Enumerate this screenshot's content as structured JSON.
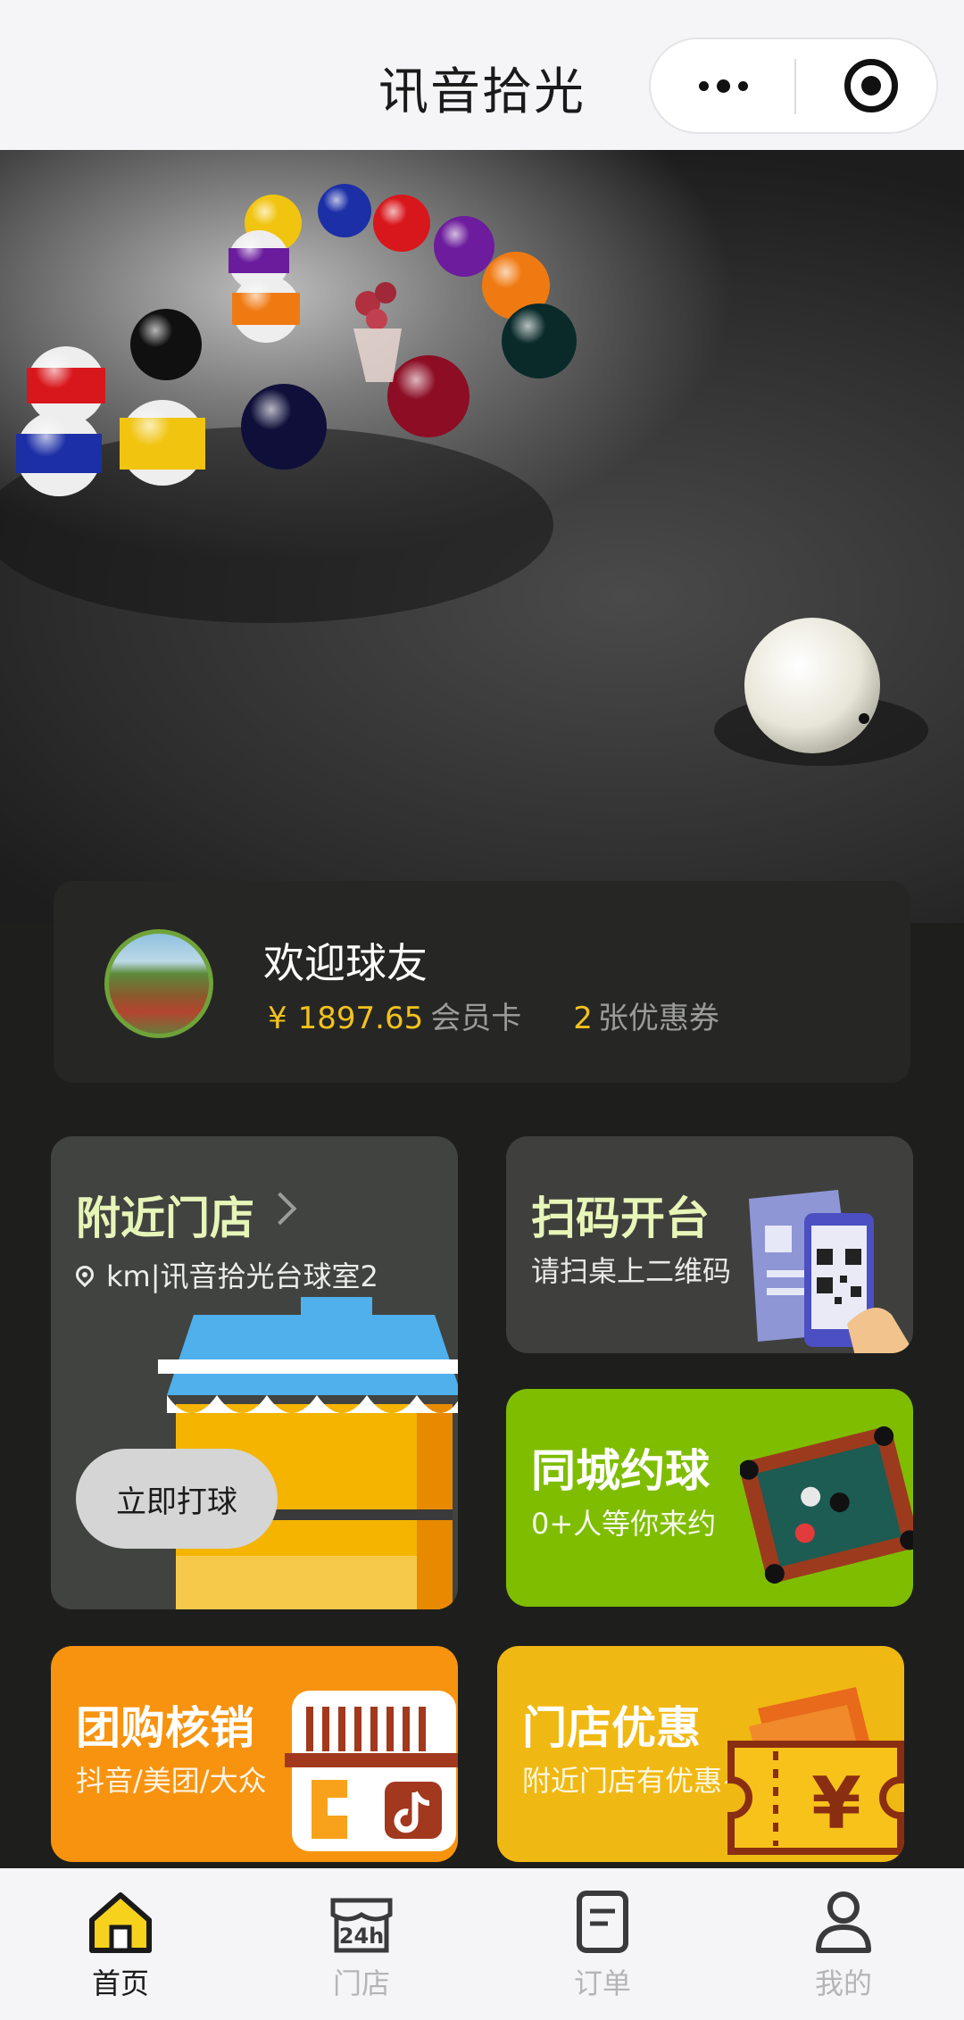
{
  "navbar": {
    "title": "讯音拾光",
    "more_icon": "more-dots-icon",
    "close_icon": "target-icon"
  },
  "banner": {
    "image": "billiard-balls-banner",
    "colors": {
      "felt": "#2a2a2a"
    }
  },
  "user": {
    "greeting": "欢迎球友",
    "currency_symbol": "¥",
    "balance": "1897.65",
    "balance_label": "会员卡",
    "coupon_count": "2",
    "coupon_label": "张优惠券"
  },
  "tiles": {
    "nearby": {
      "title": "附近门店",
      "location": "km|讯音拾光台球室2",
      "button": "立即打球"
    },
    "scan": {
      "title": "扫码开台",
      "subtitle": "请扫桌上二维码"
    },
    "match": {
      "title": "同城约球",
      "subtitle": "0+人等你来约"
    },
    "group": {
      "title": "团购核销",
      "subtitle": "抖音/美团/大众"
    },
    "promo": {
      "title": "门店优惠",
      "subtitle": "附近门店有优惠~"
    }
  },
  "tabbar": {
    "items": [
      {
        "label": "首页",
        "icon": "home-icon",
        "active": true
      },
      {
        "label": "门店",
        "icon": "store-24h-icon",
        "active": false
      },
      {
        "label": "订单",
        "icon": "order-icon",
        "active": false
      },
      {
        "label": "我的",
        "icon": "profile-icon",
        "active": false
      }
    ]
  },
  "colors": {
    "accent_yellow": "#f3c21c",
    "green_tile": "#7fbd00",
    "orange_tile": "#f7930f",
    "gold_tile": "#f0b812"
  }
}
